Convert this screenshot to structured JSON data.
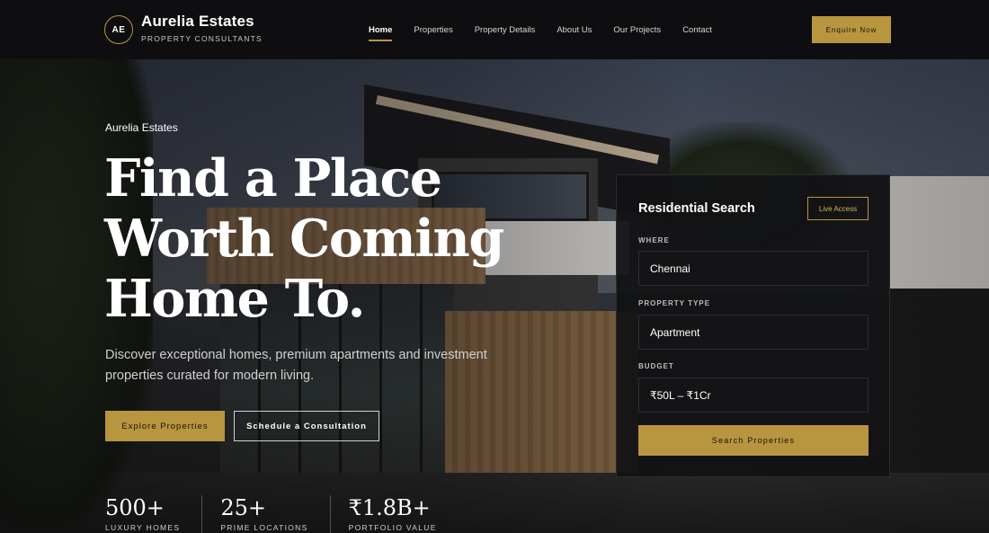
{
  "brand": {
    "initials": "AE",
    "name": "Aurelia Estates",
    "tagline": "PROPERTY CONSULTANTS"
  },
  "nav": {
    "items": [
      {
        "label": "Home",
        "active": true
      },
      {
        "label": "Properties",
        "active": false
      },
      {
        "label": "Property Details",
        "active": false
      },
      {
        "label": "About Us",
        "active": false
      },
      {
        "label": "Our Projects",
        "active": false
      },
      {
        "label": "Contact",
        "active": false
      }
    ],
    "cta_label": "Enquire Now"
  },
  "hero": {
    "eyebrow": "Aurelia Estates",
    "headline_lines": [
      "Find a Place",
      "Worth Coming",
      "Home To."
    ],
    "subtext": "Discover exceptional homes, premium apartments and investment properties curated for modern living.",
    "primary_button": "Explore Properties",
    "secondary_button": "Schedule a Consultation",
    "stats": [
      {
        "value": "500+",
        "label": "LUXURY HOMES"
      },
      {
        "value": "25+",
        "label": "PRIME LOCATIONS"
      },
      {
        "value": "₹1.8B+",
        "label": "PORTFOLIO VALUE"
      }
    ]
  },
  "search_card": {
    "title": "Residential Search",
    "badge": "Live Access",
    "fields": [
      {
        "label": "WHERE",
        "value": "Chennai"
      },
      {
        "label": "PROPERTY TYPE",
        "value": "Apartment"
      },
      {
        "label": "BUDGET",
        "value": "₹50L – ₹1Cr"
      }
    ],
    "submit_label": "Search Properties"
  },
  "colors": {
    "accent_gold": "#b8953f",
    "nav_bg": "#0e0e10",
    "card_bg": "#121214"
  }
}
